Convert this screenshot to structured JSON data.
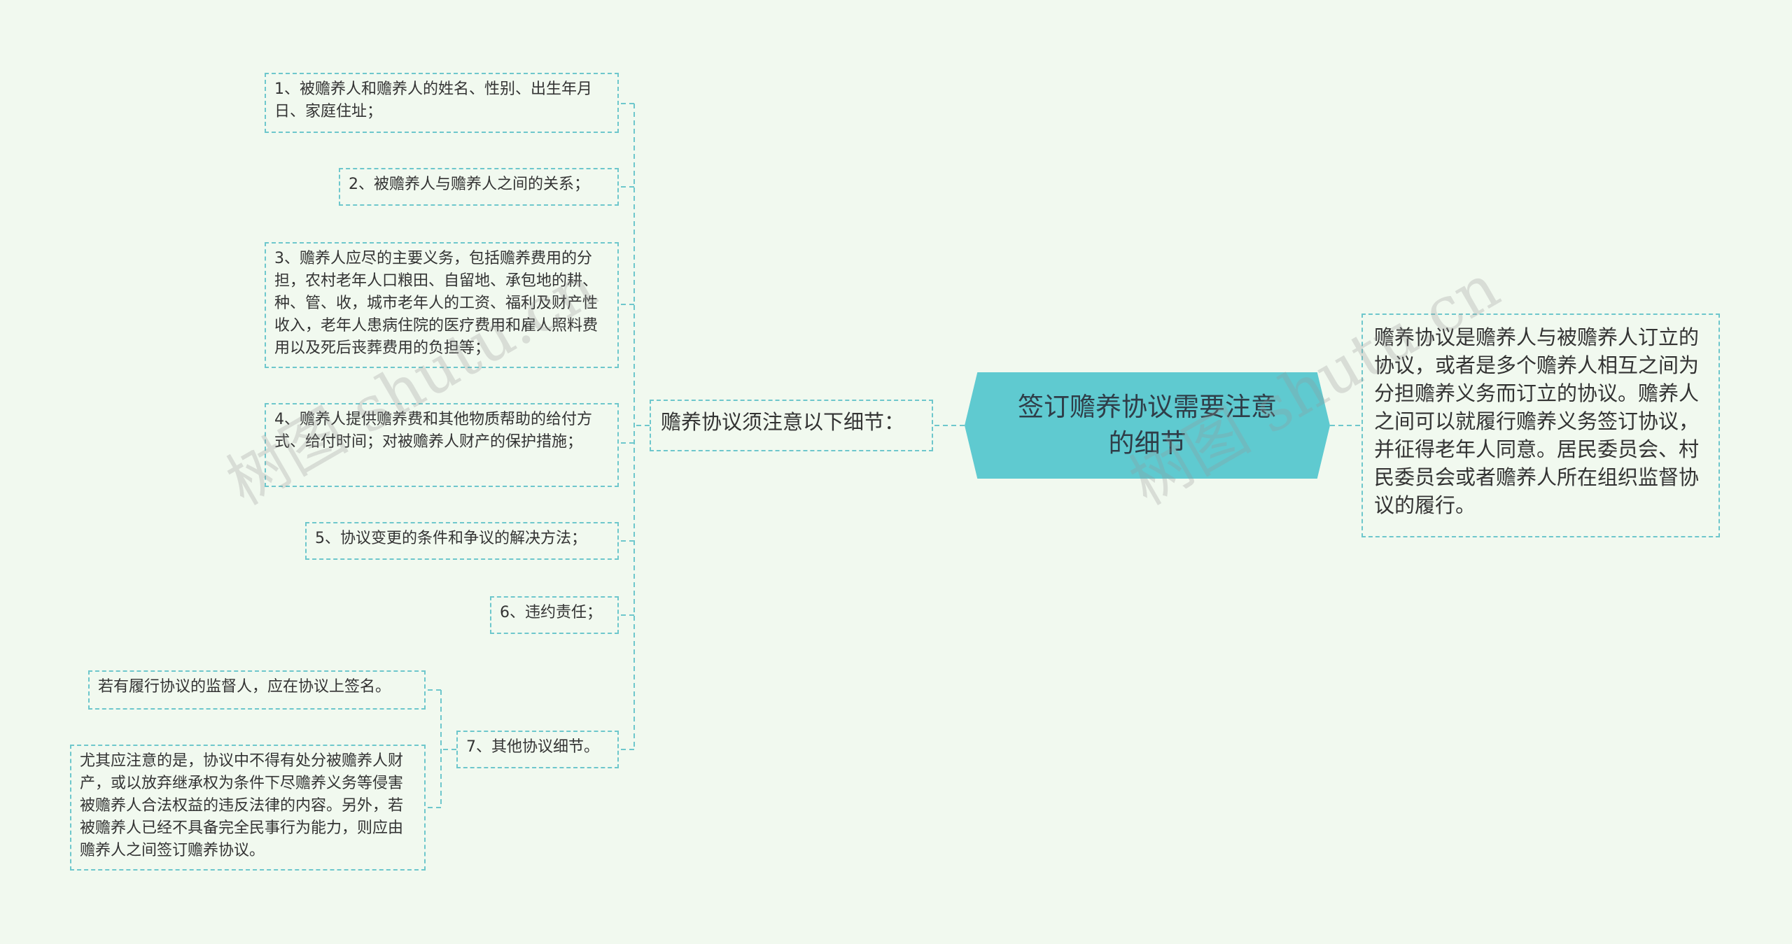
{
  "central": {
    "title": "签订赡养协议需要注意的细节"
  },
  "left_branch": {
    "label": "赡养协议须注意以下细节：",
    "items": [
      {
        "text": "1、被赡养人和赡养人的姓名、性别、出生年月日、家庭住址；"
      },
      {
        "text": "2、被赡养人与赡养人之间的关系；"
      },
      {
        "text": "3、赡养人应尽的主要义务，包括赡养费用的分担，农村老年人口粮田、自留地、承包地的耕、种、管、收，城市老年人的工资、福利及财产性收入，老年人患病住院的医疗费用和雇人照料费用以及死后丧葬费用的负担等；"
      },
      {
        "text": "4、赡养人提供赡养费和其他物质帮助的给付方式、给付时间；对被赡养人财产的保护措施；"
      },
      {
        "text": "5、协议变更的条件和争议的解决方法；"
      },
      {
        "text": "6、违约责任；"
      },
      {
        "text": "7、其他协议细节。"
      }
    ],
    "item7_children": [
      {
        "text": "若有履行协议的监督人，应在协议上签名。"
      },
      {
        "text": "尤其应注意的是，协议中不得有处分被赡养人财产，或以放弃继承权为条件下尽赡养义务等侵害被赡养人合法权益的违反法律的内容。另外，若被赡养人已经不具备完全民事行为能力，则应由赡养人之间签订赡养协议。"
      }
    ]
  },
  "right_branch": {
    "text": "赡养协议是赡养人与被赡养人订立的协议，或者是多个赡养人相互之间为分担赡养义务而订立的协议。赡养人之间可以就履行赡养义务签订协议，并征得老年人同意。居民委员会、村民委员会或者赡养人所在组织监督协议的履行。"
  },
  "watermark": "树图 shutu.cn",
  "colors": {
    "background": "#f1f9ef",
    "central_fill": "#5fcad0",
    "line": "#6ec7cc"
  }
}
